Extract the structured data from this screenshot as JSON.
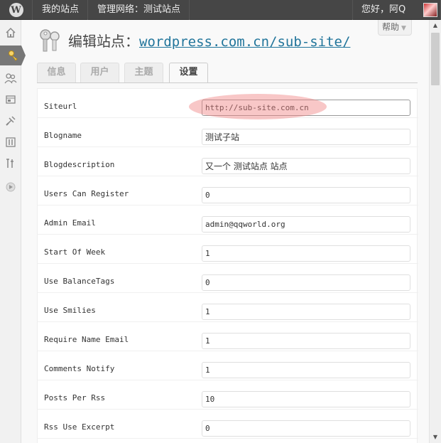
{
  "admin_bar": {
    "logo_icon": "wordpress-logo-icon",
    "my_sites": "我的站点",
    "network": "管理网络：测试站点",
    "greeting": "您好，阿Q"
  },
  "side_menu": {
    "icons": [
      "dashboard-icon",
      "sites-icon",
      "users-icon",
      "themes-icon",
      "plugins-icon",
      "tools-icon",
      "settings-icon",
      "collapse-icon"
    ],
    "active": "sites-icon"
  },
  "help": {
    "label": "帮助"
  },
  "page": {
    "title_prefix": "编辑站点：",
    "title_link": "wordpress.com.cn/sub-site/",
    "icon": "sites-keys-icon"
  },
  "tabs": [
    {
      "label": "信息"
    },
    {
      "label": "用户"
    },
    {
      "label": "主题"
    },
    {
      "label": "设置",
      "active": true
    }
  ],
  "fields": [
    {
      "label": "Siteurl",
      "value": "http://sub-site.com.cn"
    },
    {
      "label": "Blogname",
      "value": "测试子站"
    },
    {
      "label": "Blogdescription",
      "value": "又一个 测试站点 站点"
    },
    {
      "label": "Users Can Register",
      "value": "0"
    },
    {
      "label": "Admin Email",
      "value": "admin@qqworld.org"
    },
    {
      "label": "Start Of Week",
      "value": "1"
    },
    {
      "label": "Use BalanceTags",
      "value": "0"
    },
    {
      "label": "Use Smilies",
      "value": "1"
    },
    {
      "label": "Require Name Email",
      "value": "1"
    },
    {
      "label": "Comments Notify",
      "value": "1"
    },
    {
      "label": "Posts Per Rss",
      "value": "10"
    },
    {
      "label": "Rss Use Excerpt",
      "value": "0"
    }
  ],
  "colors": {
    "admin_bar": "#464646",
    "link": "#21759b",
    "highlight": "#f08282"
  }
}
